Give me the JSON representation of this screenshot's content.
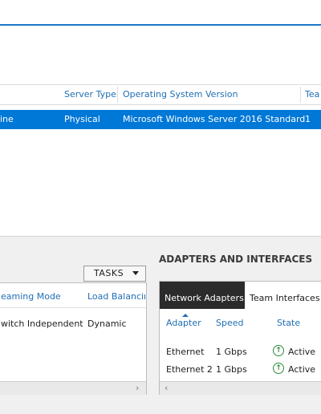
{
  "servers_table": {
    "columns": [
      "Server Type",
      "Operating System Version",
      "Tea"
    ],
    "row": {
      "name_fragment": "ine",
      "server_type": "Physical",
      "os_version": "Microsoft Windows Server 2016 Standard",
      "teams": "1"
    }
  },
  "teams_panel": {
    "tasks_label": "TASKS",
    "columns": [
      "eaming Mode",
      "Load Balancin"
    ],
    "row": {
      "mode": "witch Independent",
      "load_balancing": "Dynamic"
    }
  },
  "adapters_panel": {
    "title": "ADAPTERS AND INTERFACES",
    "tabs": [
      "Network Adapters",
      "Team Interfaces"
    ],
    "columns": [
      "Adapter",
      "Speed",
      "State"
    ],
    "rows": [
      {
        "adapter": "Ethernet",
        "speed": "1 Gbps",
        "state": "Active"
      },
      {
        "adapter": "Ethernet 2",
        "speed": "1 Gbps",
        "state": "Active"
      }
    ]
  },
  "colors": {
    "accent": "#0078d7",
    "header_link": "#1f6fb5",
    "active_green": "#2e8b3a"
  }
}
